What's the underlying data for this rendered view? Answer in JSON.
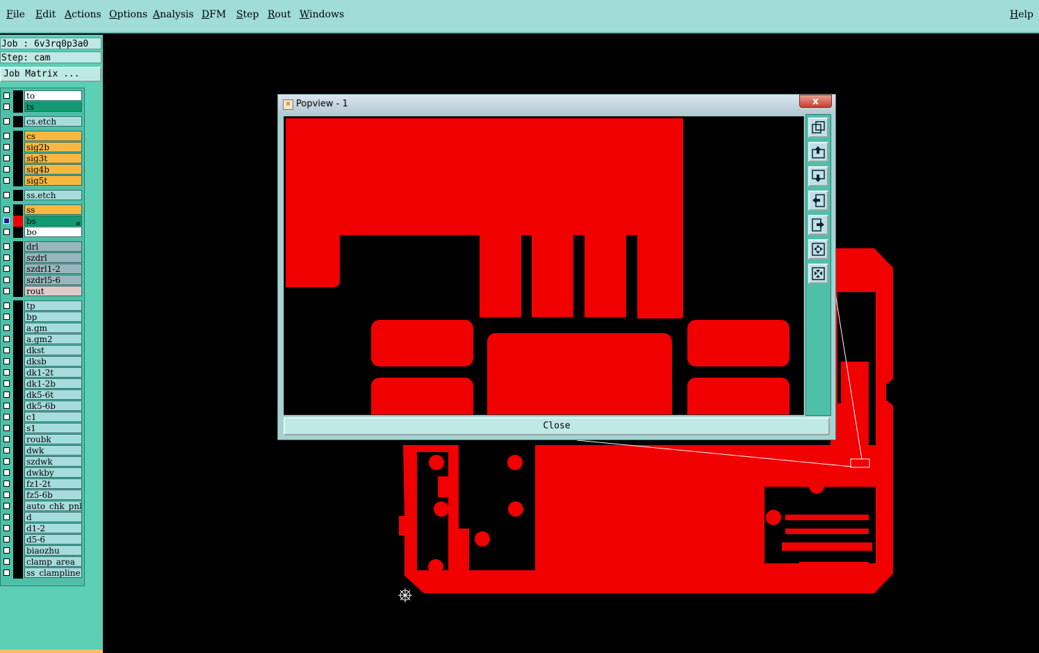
{
  "menu": {
    "items": [
      "File",
      "Edit",
      "Actions",
      "Options",
      "Analysis",
      "DFM",
      "Step",
      "Rout",
      "Windows"
    ],
    "underline": [
      "F",
      "E",
      "A",
      "O",
      "A",
      "D",
      "S",
      "R",
      "W"
    ],
    "help": "Help"
  },
  "job": {
    "job_label": "Job : 6v3rq0p3a0",
    "step_label": "Step: cam",
    "matrix_button": "Job Matrix ..."
  },
  "layers": [
    {
      "name": "to",
      "color": "#ffffff"
    },
    {
      "name": "ts",
      "color": "#129b70"
    },
    {
      "name": "cs.etch",
      "color": "#a7dcdc"
    },
    {
      "name": "cs",
      "color": "#f8b840"
    },
    {
      "name": "sig2b",
      "color": "#f8b840"
    },
    {
      "name": "sig3t",
      "color": "#f8b840"
    },
    {
      "name": "sig4b",
      "color": "#f8b840"
    },
    {
      "name": "sig5t",
      "color": "#f8b840"
    },
    {
      "name": "ss.etch",
      "color": "#a7dcdc"
    },
    {
      "name": "ss",
      "color": "#f8b840"
    },
    {
      "name": "bs",
      "color": "#129b70",
      "active": true
    },
    {
      "name": "bo",
      "color": "#ffffff"
    },
    {
      "name": "drl",
      "color": "#9ab6bd"
    },
    {
      "name": "szdrl",
      "color": "#9ab6bd"
    },
    {
      "name": "szdrl1-2",
      "color": "#9ab6bd"
    },
    {
      "name": "szdrl5-6",
      "color": "#9ab6bd"
    },
    {
      "name": "rout",
      "color": "#e4c8c8"
    },
    {
      "name": "tp",
      "color": "#a7dcdc"
    },
    {
      "name": "bp",
      "color": "#a7dcdc"
    },
    {
      "name": "a.gm",
      "color": "#a7dcdc"
    },
    {
      "name": "a.gm2",
      "color": "#a7dcdc"
    },
    {
      "name": "dkst",
      "color": "#a7dcdc"
    },
    {
      "name": "dksb",
      "color": "#a7dcdc"
    },
    {
      "name": "dk1-2t",
      "color": "#a7dcdc"
    },
    {
      "name": "dk1-2b",
      "color": "#a7dcdc"
    },
    {
      "name": "dk5-6t",
      "color": "#a7dcdc"
    },
    {
      "name": "dk5-6b",
      "color": "#a7dcdc"
    },
    {
      "name": "c1",
      "color": "#a7dcdc"
    },
    {
      "name": "s1",
      "color": "#a7dcdc"
    },
    {
      "name": "roubk",
      "color": "#a7dcdc"
    },
    {
      "name": "dwk",
      "color": "#a7dcdc"
    },
    {
      "name": "szdwk",
      "color": "#a7dcdc"
    },
    {
      "name": "dwkby",
      "color": "#a7dcdc"
    },
    {
      "name": "fz1-2t",
      "color": "#a7dcdc"
    },
    {
      "name": "fz5-6b",
      "color": "#a7dcdc"
    },
    {
      "name": "auto_chk_pnl",
      "color": "#a7dcdc"
    },
    {
      "name": "d",
      "color": "#a7dcdc"
    },
    {
      "name": "d1-2",
      "color": "#a7dcdc"
    },
    {
      "name": "d5-6",
      "color": "#a7dcdc"
    },
    {
      "name": "biaozhu",
      "color": "#a7dcdc"
    },
    {
      "name": "clamp_area",
      "color": "#a7dcdc"
    },
    {
      "name": "ss_clampline",
      "color": "#a7dcdc"
    }
  ],
  "popview": {
    "title": "Popview - 1",
    "close_x": "x",
    "close_button": "Close",
    "tool_icons": [
      "zoom-home-icon",
      "pan-up-icon",
      "pan-down-icon",
      "pan-left-icon",
      "pan-right-icon",
      "zoom-in-icon",
      "zoom-out-icon"
    ]
  },
  "colors": {
    "copper": "#f00000",
    "menubar": "#a0dcd8",
    "panel": "#5ccfb4"
  }
}
